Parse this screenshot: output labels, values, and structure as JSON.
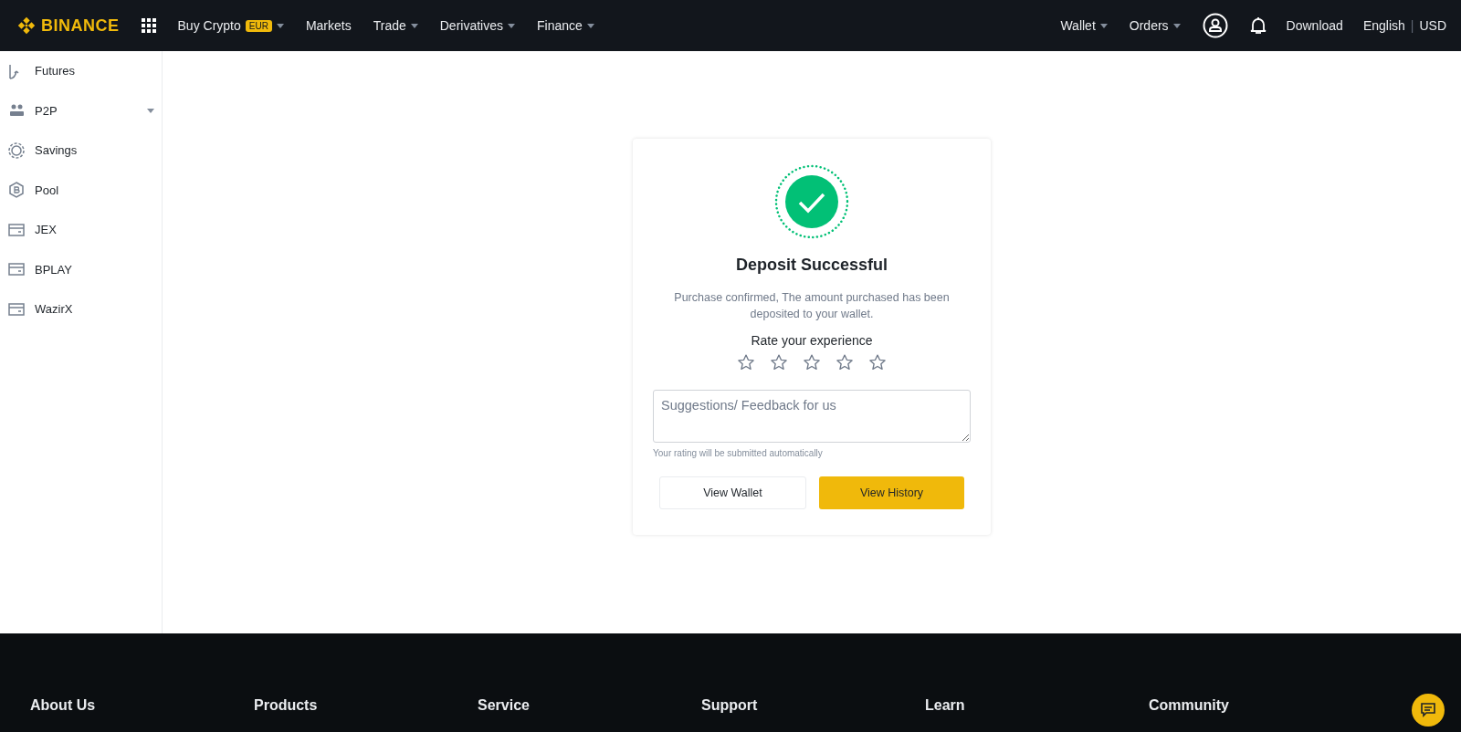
{
  "header": {
    "logo": "BINANCE",
    "nav": [
      {
        "label": "Buy Crypto",
        "badge": "EUR",
        "dropdown": true
      },
      {
        "label": "Markets",
        "dropdown": false
      },
      {
        "label": "Trade",
        "dropdown": true
      },
      {
        "label": "Derivatives",
        "dropdown": true
      },
      {
        "label": "Finance",
        "dropdown": true
      }
    ],
    "right_nav": [
      {
        "label": "Wallet",
        "dropdown": true
      },
      {
        "label": "Orders",
        "dropdown": true
      }
    ],
    "download": "Download",
    "language": "English",
    "separator": "|",
    "currency": "USD"
  },
  "sidebar": {
    "items": [
      {
        "label": "Futures",
        "kind": "futures",
        "dropdown": false
      },
      {
        "label": "P2P",
        "kind": "people",
        "dropdown": true
      },
      {
        "label": "Savings",
        "kind": "coin",
        "dropdown": false
      },
      {
        "label": "Pool",
        "kind": "pool",
        "dropdown": false
      },
      {
        "label": "JEX",
        "kind": "wallet",
        "dropdown": false
      },
      {
        "label": "BPLAY",
        "kind": "wallet",
        "dropdown": false
      },
      {
        "label": "WazirX",
        "kind": "wallet",
        "dropdown": false
      }
    ]
  },
  "card": {
    "title": "Deposit Successful",
    "message": "Purchase confirmed, The amount purchased has been deposited to your wallet.",
    "rating_prompt": "Rate your experience",
    "stars": 0,
    "feedback": {
      "placeholder": "Suggestions/ Feedback for us"
    },
    "hint": "Your rating will be submitted automatically",
    "buttons": [
      {
        "label": "View Wallet",
        "kind": "secondary"
      },
      {
        "label": "View History",
        "kind": "primary"
      }
    ]
  },
  "footer": {
    "columns": [
      "About Us",
      "Products",
      "Service",
      "Support",
      "Learn",
      "Community"
    ]
  }
}
